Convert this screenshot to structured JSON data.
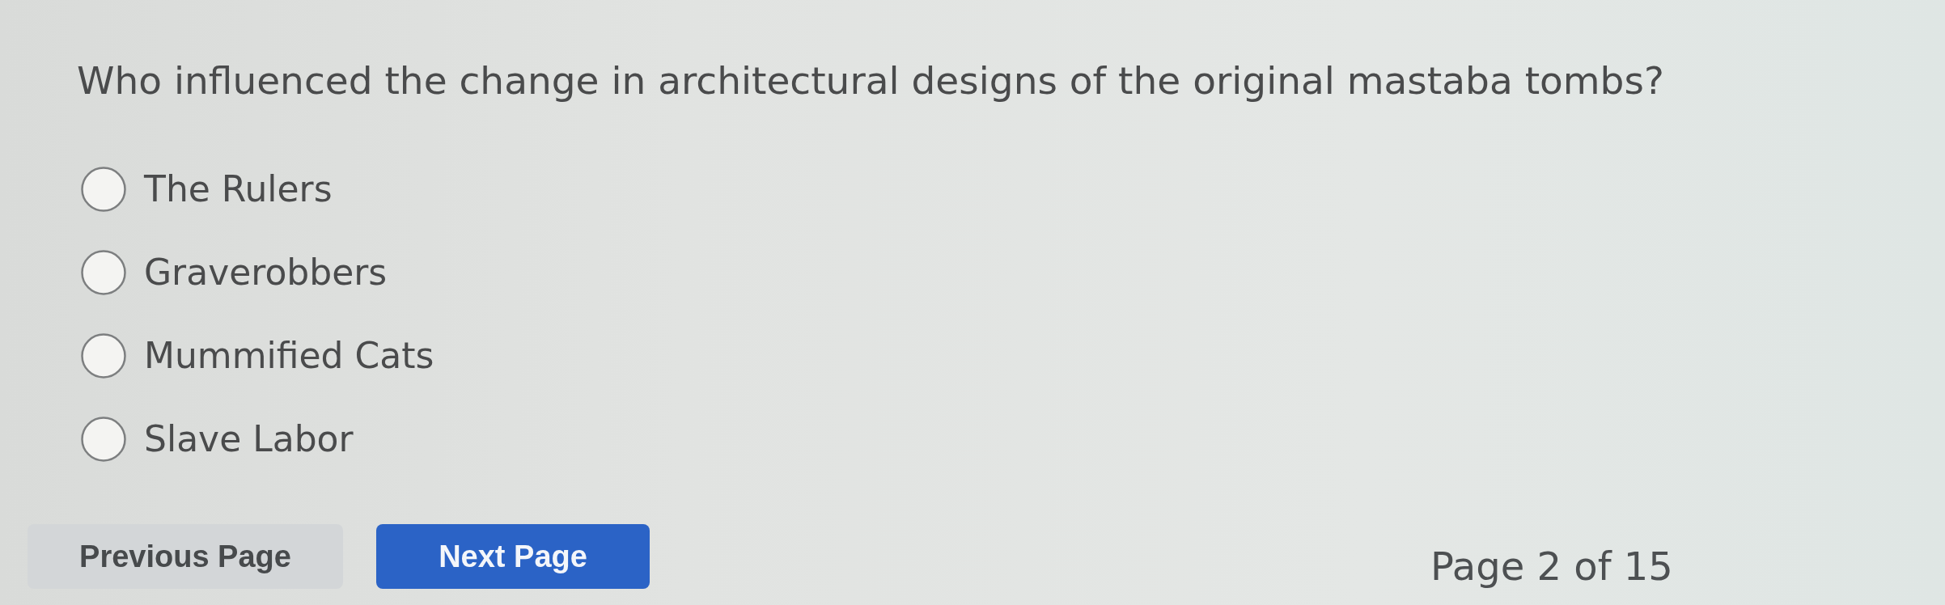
{
  "question": {
    "text": "Who influenced the change in architectural designs of the original mastaba tombs?"
  },
  "options": [
    {
      "label": "The Rulers",
      "selected": false
    },
    {
      "label": "Graverobbers",
      "selected": false
    },
    {
      "label": "Mummified Cats",
      "selected": false
    },
    {
      "label": "Slave Labor",
      "selected": false
    }
  ],
  "navigation": {
    "buttons": [
      {
        "label": "Previous Page",
        "kind": "secondary"
      },
      {
        "label": "Next Page",
        "kind": "primary"
      }
    ],
    "page_indicator": "Page 2 of 15"
  }
}
